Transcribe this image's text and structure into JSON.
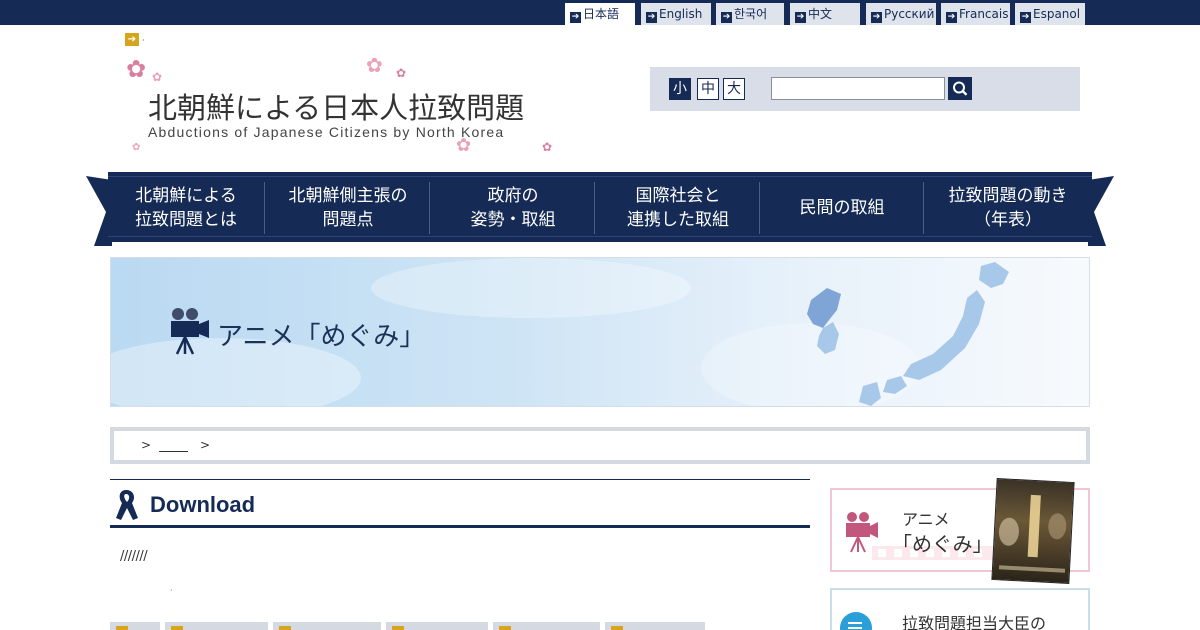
{
  "language_bar": {
    "items": [
      {
        "label": "日本語",
        "active": true
      },
      {
        "label": "English",
        "active": false
      },
      {
        "label": "한국어",
        "active": false
      },
      {
        "label": "中文",
        "active": false
      },
      {
        "label": "Русский",
        "active": false
      },
      {
        "label": "Francais",
        "active": false
      },
      {
        "label": "Espanol",
        "active": false
      }
    ],
    "bg_color": "#152b55"
  },
  "header": {
    "arrow_text": "·",
    "title": "北朝鮮による日本人拉致問題",
    "subtitle": "Abductions of Japanese Citizens by North Korea",
    "font_sizes": {
      "small": "小",
      "medium": "中",
      "large": "大"
    },
    "search_value": ""
  },
  "global_nav": {
    "items": [
      {
        "line1": "北朝鮮による",
        "line2": "拉致問題とは"
      },
      {
        "line1": "北朝鮮側主張の",
        "line2": "問題点"
      },
      {
        "line1": "政府の",
        "line2": "姿勢・取組"
      },
      {
        "line1": "国際社会と",
        "line2": "連携した取組"
      },
      {
        "line1": "民間の取組",
        "line2": ""
      },
      {
        "line1": "拉致問題の動き",
        "line2": "（年表）"
      }
    ],
    "color": "#152b55"
  },
  "banner": {
    "title": "アニメ「めぐみ」",
    "icon": "movie-camera-icon"
  },
  "breadcrumb": {
    "sep": ">"
  },
  "main": {
    "heading": "Download",
    "heading_icon": "ribbon-icon",
    "slashes": "///////",
    "dot": "·"
  },
  "side": {
    "anime_line1": "アニメ",
    "anime_line2": "「めぐみ」",
    "minister_label": "拉致問題担当大臣の"
  },
  "colors": {
    "navy": "#152b55",
    "pink": "#f1c7d3",
    "gold": "#d7a51c",
    "light_blue": "#bad9f2"
  }
}
